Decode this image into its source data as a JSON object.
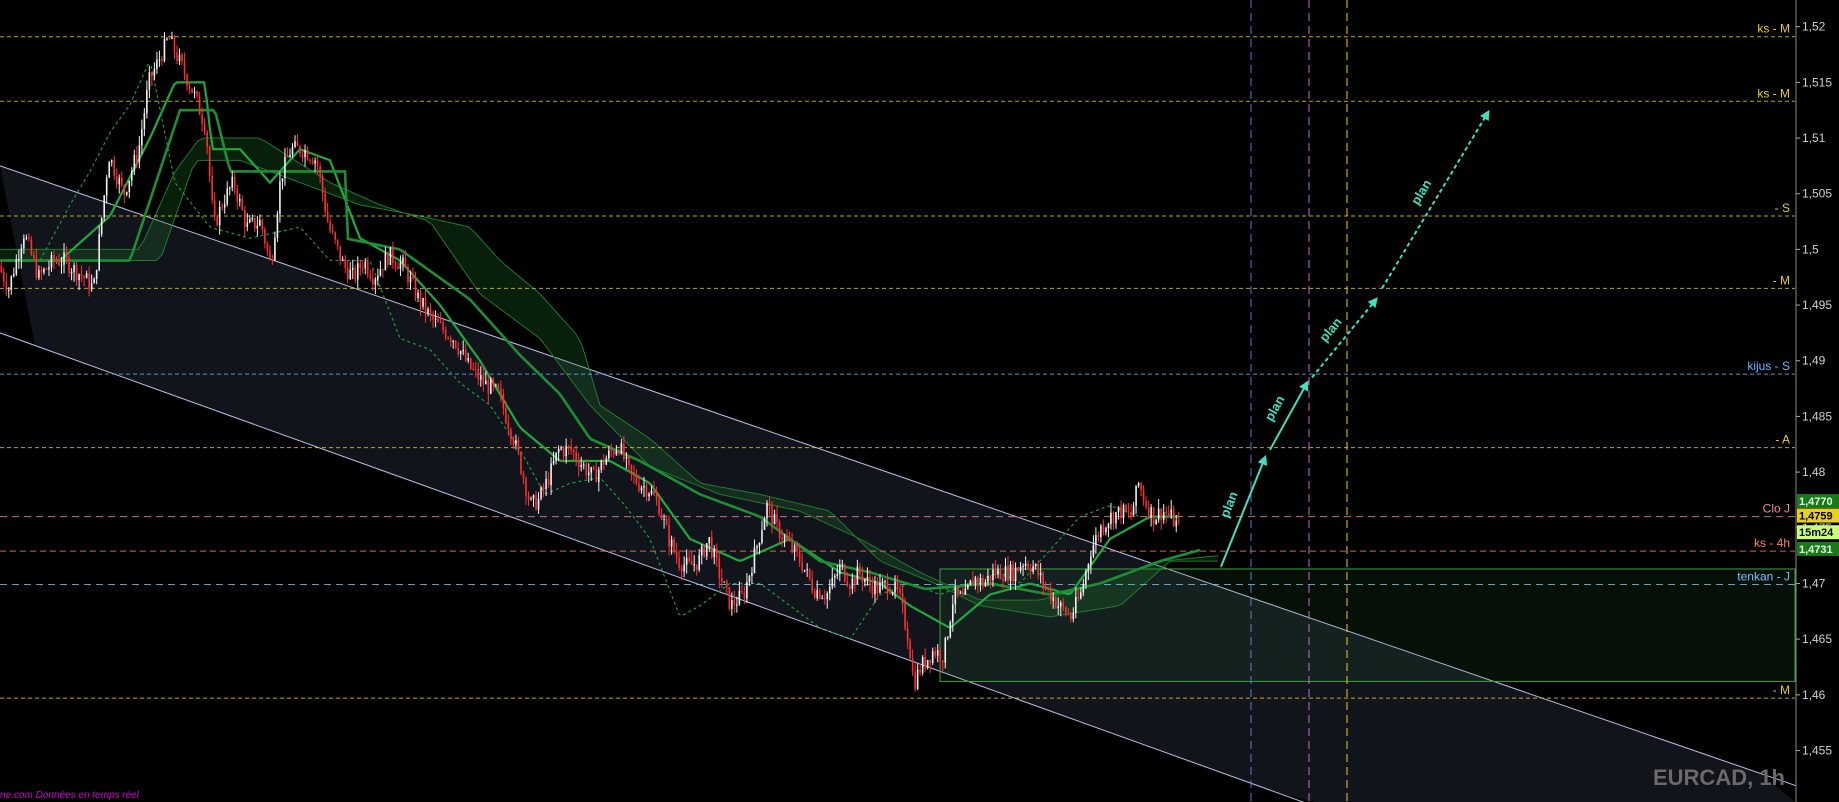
{
  "chart_data": {
    "type": "candlestick",
    "symbol_label": "EURCAD, 1h",
    "source_label": "ne.com  Données en temps réel",
    "ylim": [
      1.451,
      1.5215
    ],
    "y_ticks": [
      "1,52",
      "1,515",
      "1,51",
      "1,505",
      "1,5",
      "1,495",
      "1,49",
      "1,485",
      "1,48",
      "1,475",
      "1,47",
      "1,465",
      "1,46",
      "1,455"
    ],
    "y_tick_values": [
      1.52,
      1.515,
      1.51,
      1.505,
      1.5,
      1.495,
      1.49,
      1.485,
      1.48,
      1.475,
      1.47,
      1.465,
      1.46,
      1.455
    ],
    "x_bars": 470,
    "price_keypoints": [
      [
        0,
        1.4985
      ],
      [
        10,
        1.4965
      ],
      [
        25,
        1.5015
      ],
      [
        40,
        1.4975
      ],
      [
        55,
        1.499
      ],
      [
        65,
        1.499
      ],
      [
        85,
        1.4975
      ],
      [
        95,
        1.4965
      ],
      [
        110,
        1.5085
      ],
      [
        125,
        1.505
      ],
      [
        140,
        1.509
      ],
      [
        150,
        1.515
      ],
      [
        170,
        1.519
      ],
      [
        180,
        1.517
      ],
      [
        195,
        1.514
      ],
      [
        207,
        1.511
      ],
      [
        215,
        1.502
      ],
      [
        225,
        1.5045
      ],
      [
        235,
        1.506
      ],
      [
        248,
        1.502
      ],
      [
        262,
        1.5025
      ],
      [
        272,
        1.4985
      ],
      [
        282,
        1.5065
      ],
      [
        292,
        1.509
      ],
      [
        305,
        1.509
      ],
      [
        318,
        1.508
      ],
      [
        330,
        1.502
      ],
      [
        345,
        1.4985
      ],
      [
        355,
        1.4975
      ],
      [
        365,
        1.499
      ],
      [
        375,
        1.4975
      ],
      [
        390,
        1.4995
      ],
      [
        405,
        1.4985
      ],
      [
        420,
        1.4955
      ],
      [
        435,
        1.4935
      ],
      [
        455,
        1.492
      ],
      [
        470,
        1.4895
      ],
      [
        485,
        1.488
      ],
      [
        500,
        1.487
      ],
      [
        515,
        1.483
      ],
      [
        525,
        1.4795
      ],
      [
        532,
        1.477
      ],
      [
        540,
        1.4775
      ],
      [
        550,
        1.4795
      ],
      [
        560,
        1.482
      ],
      [
        572,
        1.482
      ],
      [
        585,
        1.4805
      ],
      [
        595,
        1.4795
      ],
      [
        605,
        1.481
      ],
      [
        620,
        1.4825
      ],
      [
        630,
        1.48
      ],
      [
        640,
        1.479
      ],
      [
        650,
        1.4785
      ],
      [
        660,
        1.477
      ],
      [
        670,
        1.474
      ],
      [
        680,
        1.472
      ],
      [
        690,
        1.4715
      ],
      [
        700,
        1.472
      ],
      [
        710,
        1.474
      ],
      [
        720,
        1.471
      ],
      [
        732,
        1.468
      ],
      [
        745,
        1.469
      ],
      [
        760,
        1.474
      ],
      [
        768,
        1.477
      ],
      [
        778,
        1.475
      ],
      [
        790,
        1.4735
      ],
      [
        802,
        1.472
      ],
      [
        815,
        1.4695
      ],
      [
        828,
        1.469
      ],
      [
        842,
        1.4715
      ],
      [
        852,
        1.47
      ],
      [
        860,
        1.471
      ],
      [
        870,
        1.47
      ],
      [
        880,
        1.4695
      ],
      [
        890,
        1.47
      ],
      [
        900,
        1.469
      ],
      [
        910,
        1.465
      ],
      [
        915,
        1.461
      ],
      [
        922,
        1.4625
      ],
      [
        935,
        1.464
      ],
      [
        945,
        1.4635
      ],
      [
        955,
        1.469
      ],
      [
        965,
        1.4685
      ],
      [
        975,
        1.4705
      ],
      [
        985,
        1.47
      ],
      [
        995,
        1.471
      ],
      [
        1005,
        1.471
      ],
      [
        1015,
        1.471
      ],
      [
        1025,
        1.472
      ],
      [
        1035,
        1.4715
      ],
      [
        1048,
        1.4695
      ],
      [
        1060,
        1.468
      ],
      [
        1072,
        1.467
      ],
      [
        1082,
        1.469
      ],
      [
        1092,
        1.473
      ],
      [
        1102,
        1.475
      ],
      [
        1112,
        1.476
      ],
      [
        1122,
        1.4765
      ],
      [
        1132,
        1.476
      ],
      [
        1140,
        1.479
      ],
      [
        1148,
        1.477
      ],
      [
        1155,
        1.476
      ],
      [
        1164,
        1.4765
      ],
      [
        1172,
        1.476
      ],
      [
        1180,
        1.475
      ]
    ],
    "tenkan_keypoints": [
      [
        0,
        1.499
      ],
      [
        60,
        1.499
      ],
      [
        110,
        1.503
      ],
      [
        150,
        1.51
      ],
      [
        175,
        1.515
      ],
      [
        205,
        1.515
      ],
      [
        212,
        1.509
      ],
      [
        240,
        1.509
      ],
      [
        270,
        1.506
      ],
      [
        300,
        1.509
      ],
      [
        330,
        1.508
      ],
      [
        360,
        1.501
      ],
      [
        400,
        1.499
      ],
      [
        440,
        1.495
      ],
      [
        480,
        1.49
      ],
      [
        520,
        1.484
      ],
      [
        560,
        1.481
      ],
      [
        610,
        1.481
      ],
      [
        650,
        1.479
      ],
      [
        690,
        1.474
      ],
      [
        740,
        1.472
      ],
      [
        790,
        1.474
      ],
      [
        840,
        1.471
      ],
      [
        880,
        1.47
      ],
      [
        910,
        1.468
      ],
      [
        950,
        1.466
      ],
      [
        990,
        1.469
      ],
      [
        1030,
        1.47
      ],
      [
        1070,
        1.469
      ],
      [
        1110,
        1.474
      ],
      [
        1150,
        1.476
      ],
      [
        1180,
        1.476
      ]
    ],
    "kijun_keypoints": [
      [
        0,
        1.499
      ],
      [
        130,
        1.499
      ],
      [
        180,
        1.5125
      ],
      [
        215,
        1.5125
      ],
      [
        230,
        1.507
      ],
      [
        300,
        1.507
      ],
      [
        345,
        1.507
      ],
      [
        345,
        1.501
      ],
      [
        400,
        1.5
      ],
      [
        470,
        1.4955
      ],
      [
        520,
        1.4905
      ],
      [
        560,
        1.487
      ],
      [
        590,
        1.483
      ],
      [
        640,
        1.481
      ],
      [
        700,
        1.478
      ],
      [
        760,
        1.476
      ],
      [
        820,
        1.472
      ],
      [
        870,
        1.471
      ],
      [
        925,
        1.4695
      ],
      [
        990,
        1.47
      ],
      [
        1050,
        1.469
      ],
      [
        1100,
        1.47
      ],
      [
        1160,
        1.472
      ],
      [
        1200,
        1.473
      ]
    ],
    "senkou_a_keypoints": [
      [
        0,
        1.5
      ],
      [
        140,
        1.5
      ],
      [
        175,
        1.507
      ],
      [
        200,
        1.51
      ],
      [
        260,
        1.51
      ],
      [
        330,
        1.506
      ],
      [
        380,
        1.504
      ],
      [
        430,
        1.5025
      ],
      [
        480,
        1.496
      ],
      [
        540,
        1.492
      ],
      [
        590,
        1.486
      ],
      [
        650,
        1.4805
      ],
      [
        720,
        1.478
      ],
      [
        800,
        1.4765
      ],
      [
        860,
        1.474
      ],
      [
        920,
        1.471
      ],
      [
        980,
        1.4685
      ],
      [
        1040,
        1.4685
      ],
      [
        1100,
        1.47
      ],
      [
        1160,
        1.472
      ],
      [
        1220,
        1.4725
      ]
    ],
    "senkou_b_keypoints": [
      [
        0,
        1.499
      ],
      [
        160,
        1.499
      ],
      [
        195,
        1.508
      ],
      [
        240,
        1.508
      ],
      [
        300,
        1.506
      ],
      [
        360,
        1.504
      ],
      [
        420,
        1.503
      ],
      [
        470,
        1.502
      ],
      [
        500,
        1.499
      ],
      [
        540,
        1.496
      ],
      [
        580,
        1.492
      ],
      [
        600,
        1.486
      ],
      [
        650,
        1.483
      ],
      [
        700,
        1.479
      ],
      [
        760,
        1.478
      ],
      [
        830,
        1.4765
      ],
      [
        880,
        1.472
      ],
      [
        935,
        1.47
      ],
      [
        980,
        1.468
      ],
      [
        1050,
        1.467
      ],
      [
        1120,
        1.468
      ],
      [
        1170,
        1.472
      ],
      [
        1220,
        1.472
      ]
    ],
    "chikou_keypoints": [
      [
        40,
        1.499
      ],
      [
        70,
        1.504
      ],
      [
        90,
        1.507
      ],
      [
        110,
        1.5105
      ],
      [
        130,
        1.513
      ],
      [
        150,
        1.517
      ],
      [
        175,
        1.506
      ],
      [
        210,
        1.502
      ],
      [
        250,
        1.501
      ],
      [
        300,
        1.502
      ],
      [
        330,
        1.499
      ],
      [
        370,
        1.499
      ],
      [
        400,
        1.492
      ],
      [
        430,
        1.491
      ],
      [
        460,
        1.488
      ],
      [
        490,
        1.486
      ],
      [
        520,
        1.482
      ],
      [
        545,
        1.478
      ],
      [
        570,
        1.479
      ],
      [
        600,
        1.4795
      ],
      [
        625,
        1.477
      ],
      [
        650,
        1.474
      ],
      [
        680,
        1.467
      ],
      [
        700,
        1.468
      ],
      [
        730,
        1.47
      ],
      [
        760,
        1.47
      ],
      [
        790,
        1.468
      ],
      [
        820,
        1.466
      ],
      [
        850,
        1.465
      ],
      [
        880,
        1.469
      ],
      [
        910,
        1.47
      ],
      [
        940,
        1.469
      ],
      [
        970,
        1.47
      ],
      [
        1000,
        1.471
      ],
      [
        1020,
        1.47
      ],
      [
        1050,
        1.473
      ],
      [
        1080,
        1.476
      ],
      [
        1110,
        1.477
      ],
      [
        1140,
        1.476
      ]
    ],
    "channel": {
      "upper": [
        [
          0,
          1.5075
        ],
        [
          1839,
          1.4505
        ]
      ],
      "lower": [
        [
          0,
          1.4925
        ],
        [
          1330,
          1.4495
        ]
      ]
    },
    "consolidation_box": {
      "x1": 940,
      "x2": 1839,
      "top": 1.4713,
      "bottom": 1.4612
    },
    "green_line_level": 1.4713,
    "levels": [
      {
        "label": "ks - M",
        "value": 1.5191,
        "color": "#e8d020",
        "dash": "4,3"
      },
      {
        "label": "ks - M",
        "value": 1.5133,
        "color": "#e8d020",
        "dash": "4,3"
      },
      {
        "label": "- S",
        "value": 1.503,
        "color": "#e8d020",
        "dash": "4,3"
      },
      {
        "label": "- M",
        "value": 1.4965,
        "color": "#e8d020",
        "dash": "4,3"
      },
      {
        "label": "kijus - S",
        "value": 1.4888,
        "color": "#62b8ff",
        "dash": "4,3",
        "extra_color": "#e8d020",
        "extra": "- S"
      },
      {
        "label": "- A",
        "value": 1.4822,
        "color": "#e8d020",
        "dash": "4,3"
      },
      {
        "label": "Clo J",
        "value": 1.476,
        "color": "#f08aa0",
        "dash": "7,5"
      },
      {
        "label": "ks - 4h",
        "value": 1.4729,
        "color": "#ff8060",
        "dash": "6,4"
      },
      {
        "label": "tenkan - J",
        "value": 1.4699,
        "color": "#72c4ff",
        "dash": "7,5"
      },
      {
        "label": "- M",
        "value": 1.4597,
        "color": "#e8d020",
        "dash": "4,3"
      }
    ],
    "verticals": [
      {
        "x": 1251,
        "color": "#5a7ad8"
      },
      {
        "x": 1309,
        "color": "#c070d0"
      },
      {
        "x": 1347,
        "color": "#e8d020"
      }
    ],
    "plan_arrows": [
      {
        "label": "plan",
        "from": [
          1221,
          1.4715
        ],
        "to": [
          1265,
          1.4813
        ]
      },
      {
        "label": "plan",
        "from": [
          1270,
          1.482
        ],
        "to": [
          1307,
          1.488
        ]
      },
      {
        "label": "plan",
        "from": [
          1312,
          1.4885
        ],
        "to": [
          1376,
          1.4955
        ]
      },
      {
        "label": "plan",
        "from": [
          1382,
          1.4965
        ],
        "to": [
          1488,
          1.5123
        ]
      }
    ],
    "price_badges": [
      {
        "text": "1,4770",
        "value": 1.4774,
        "bg": "#1a7a1a",
        "fg": "#e0ffe0"
      },
      {
        "text": "1,4759",
        "value": 1.4761,
        "bg": "#e8d020",
        "fg": "#000"
      },
      {
        "text": "15m24",
        "value": 1.4746,
        "bg": "#c8ff7a",
        "fg": "#000"
      },
      {
        "text": "1,4731",
        "value": 1.4731,
        "bg": "#1a7a1a",
        "fg": "#e0ffe0"
      }
    ]
  }
}
